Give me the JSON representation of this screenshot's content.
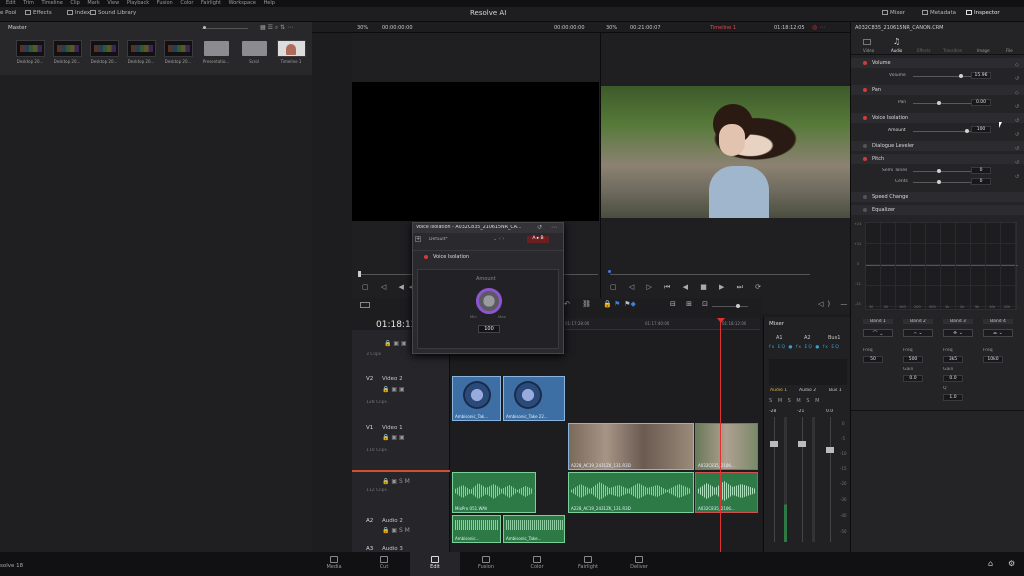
{
  "menubar": {
    "items": [
      "Edit",
      "Trim",
      "Timeline",
      "Clip",
      "Mark",
      "View",
      "Playback",
      "Fusion",
      "Color",
      "Fairlight",
      "Workspace",
      "Help"
    ]
  },
  "toolbar": {
    "media_pool": "e Pool",
    "effects": "Effects",
    "index": "Index",
    "sound_library": "Sound Library",
    "app_title": "Resolve AI",
    "mixer": "Mixer",
    "metadata": "Metadata",
    "inspector": "Inspector"
  },
  "media_pool": {
    "bin_name": "Master",
    "items": [
      "Desktop 20...",
      "Desktop 20...",
      "Desktop 20...",
      "Desktop 20...",
      "Desktop 20...",
      "Presentatio...",
      "Scrol",
      "Timeline 1"
    ]
  },
  "viewers": {
    "src_zoom": "30%",
    "src_timecode": "00:00:00:00",
    "src_timecode2": "00:00:00:00",
    "prog_zoom": "30%",
    "prog_duration": "00:21:00:07",
    "timeline_name": "Timeline 1",
    "prog_timecode": "01:18:12:05"
  },
  "inspector": {
    "clip_name": "A032C835_210615NR_CANON.CRM",
    "tabs": [
      "Video",
      "Audio",
      "Effects",
      "Transition",
      "Image",
      "File"
    ],
    "volume": {
      "title": "Volume",
      "label": "Volume",
      "value": "15.96"
    },
    "pan": {
      "title": "Pan",
      "label": "Pan",
      "value": "0.00"
    },
    "voice_isolation": {
      "title": "Voice Isolation",
      "label": "Amount",
      "value": "100"
    },
    "dialogue_leveler": "Dialogue Leveler",
    "pitch": {
      "title": "Pitch",
      "semi_label": "Semi Tones",
      "semi_value": "0",
      "cents_label": "Cents",
      "cents_value": "0"
    },
    "speed_change": "Speed Change",
    "equalizer": {
      "title": "Equalizer",
      "db_labels": [
        "+24",
        "+12",
        "0",
        "-12",
        "-24"
      ],
      "freq_labels": [
        "30",
        "50",
        "100",
        "200",
        "500",
        "1k",
        "2k",
        "5k",
        "10k",
        "20k"
      ],
      "bands": [
        "Band 1",
        "Band 2",
        "Band 3",
        "Band 4"
      ],
      "band_freq_label": "Freq",
      "band1_freq": "50",
      "band2_freq": "500",
      "band3_freq": "3k5",
      "band4_freq": "10k0",
      "gain_label": "Gain",
      "band2_gain": "0.0",
      "band3_gain": "0.0",
      "q_label": "Q",
      "band3_q": "1.0"
    }
  },
  "voice_isolation_window": {
    "title": "Voice Isolation - A032C835_210615NR_CA...",
    "preset": "Default*",
    "enable_label": "Voice Isolation",
    "amount_label": "Amount",
    "min": "Min",
    "max": "Max",
    "value": "100"
  },
  "timeline": {
    "timecode": "01:18:12",
    "ruler": [
      "01:17:28:00",
      "01:17:40:00",
      "01:18:12:00"
    ],
    "tracks": [
      {
        "id": "",
        "name": "",
        "clips": "3 Clips"
      },
      {
        "id": "V2",
        "name": "Video 2",
        "clips": "128 Clips"
      },
      {
        "id": "V1",
        "name": "Video 1",
        "clips": "110 Clips"
      },
      {
        "id": "",
        "name": "",
        "clips": "112 Clips"
      },
      {
        "id": "A2",
        "name": "Audio 2",
        "clips": ""
      },
      {
        "id": "A3",
        "name": "Audio 3",
        "clips": ""
      }
    ],
    "clip_names": {
      "v2_a": "Ambisonic_Tak...",
      "v2_b": "Ambisonic_Take 22...",
      "v1_a": "A228_AC19_2431ZK_131.R3D",
      "v1_b": "A032C835_2106...",
      "a1_a": "MixPro 051.WAV",
      "a1_b": "A228_AC19_2431ZK_131.R3D",
      "a1_c": "A032C835_2106...",
      "a2_a": "Ambisonic...",
      "a2_b": "Ambisonic_Take..."
    }
  },
  "mixer": {
    "title": "Mixer",
    "channels": [
      "A1",
      "A2",
      "Bus1"
    ],
    "channel_names": [
      "Audio 1",
      "Audio 2",
      "Bus 1"
    ],
    "db_values": [
      "-28",
      "-21",
      "0.0"
    ],
    "scale": [
      "0",
      "-5",
      "-10",
      "-15",
      "-20",
      "-30",
      "-40",
      "-50"
    ]
  },
  "pages": [
    "Media",
    "Cut",
    "Edit",
    "Fusion",
    "Color",
    "Fairlight",
    "Deliver"
  ],
  "app_version": "solve 18",
  "colors": {
    "accent_red": "#d13b3b",
    "clip_video": "#3d6fa5",
    "clip_audio": "#2e7a46",
    "playhead": "#e03030"
  }
}
